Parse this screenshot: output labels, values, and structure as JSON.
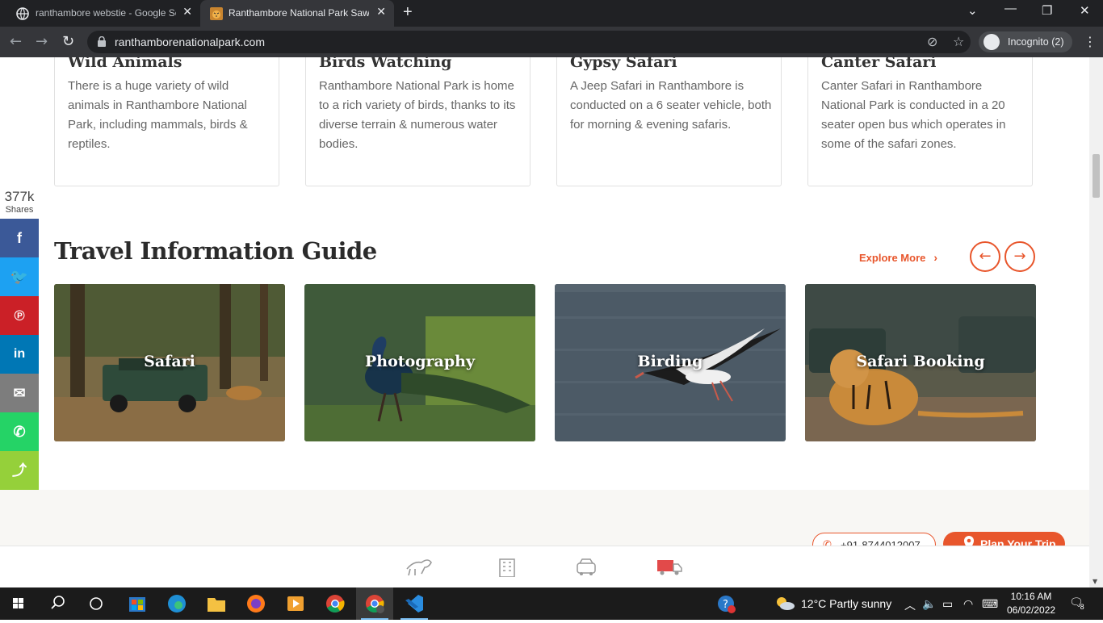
{
  "browser": {
    "tabs": [
      {
        "title": "ranthambore webstie - Google Se",
        "active": false
      },
      {
        "title": "Ranthambore National Park Sawai",
        "active": true
      }
    ],
    "url": "ranthamborenationalpark.com",
    "incognito_label": "Incognito (2)"
  },
  "cards": [
    {
      "title": "Wild Animals",
      "text": "There is a huge variety of wild animals in Ranthambore National Park, including mammals, birds & reptiles."
    },
    {
      "title": "Birds Watching",
      "text": "Ranthambore National Park is home to a rich variety of birds, thanks to its diverse terrain & numerous water bodies."
    },
    {
      "title": "Gypsy Safari",
      "text": "A Jeep Safari in Ranthambore is conducted on a 6 seater vehicle, both for morning & evening safaris."
    },
    {
      "title": "Canter Safari",
      "text": "Canter Safari in Ranthambore National Park is conducted in a 20 seater open bus which operates in some of the safari zones."
    }
  ],
  "travel_guide": {
    "title": "Travel Information Guide",
    "explore_label": "Explore More",
    "tiles": [
      {
        "label": "Safari"
      },
      {
        "label": "Photography"
      },
      {
        "label": "Birding"
      },
      {
        "label": "Safari Booking"
      }
    ]
  },
  "share": {
    "count": "377k",
    "count_label": "Shares",
    "buttons": [
      {
        "name": "facebook",
        "glyph": "f",
        "color": "#3b5998"
      },
      {
        "name": "twitter",
        "glyph": "t",
        "color": "#1da1f2"
      },
      {
        "name": "pinterest",
        "glyph": "p",
        "color": "#cb2027"
      },
      {
        "name": "linkedin",
        "glyph": "in",
        "color": "#0077b5"
      },
      {
        "name": "email",
        "glyph": "✉",
        "color": "#7d7d7d"
      },
      {
        "name": "whatsapp",
        "glyph": "✆",
        "color": "#25d366"
      },
      {
        "name": "share",
        "glyph": "⋖",
        "color": "#95d03a"
      }
    ]
  },
  "contact": {
    "phone": "+91-8744012007",
    "plan_label": "Plan Your Trip"
  },
  "colors": {
    "accent": "#e8562c"
  },
  "taskbar": {
    "weather": "12°C  Partly sunny",
    "time": "10:16 AM",
    "date": "06/02/2022",
    "notifications": "8"
  }
}
